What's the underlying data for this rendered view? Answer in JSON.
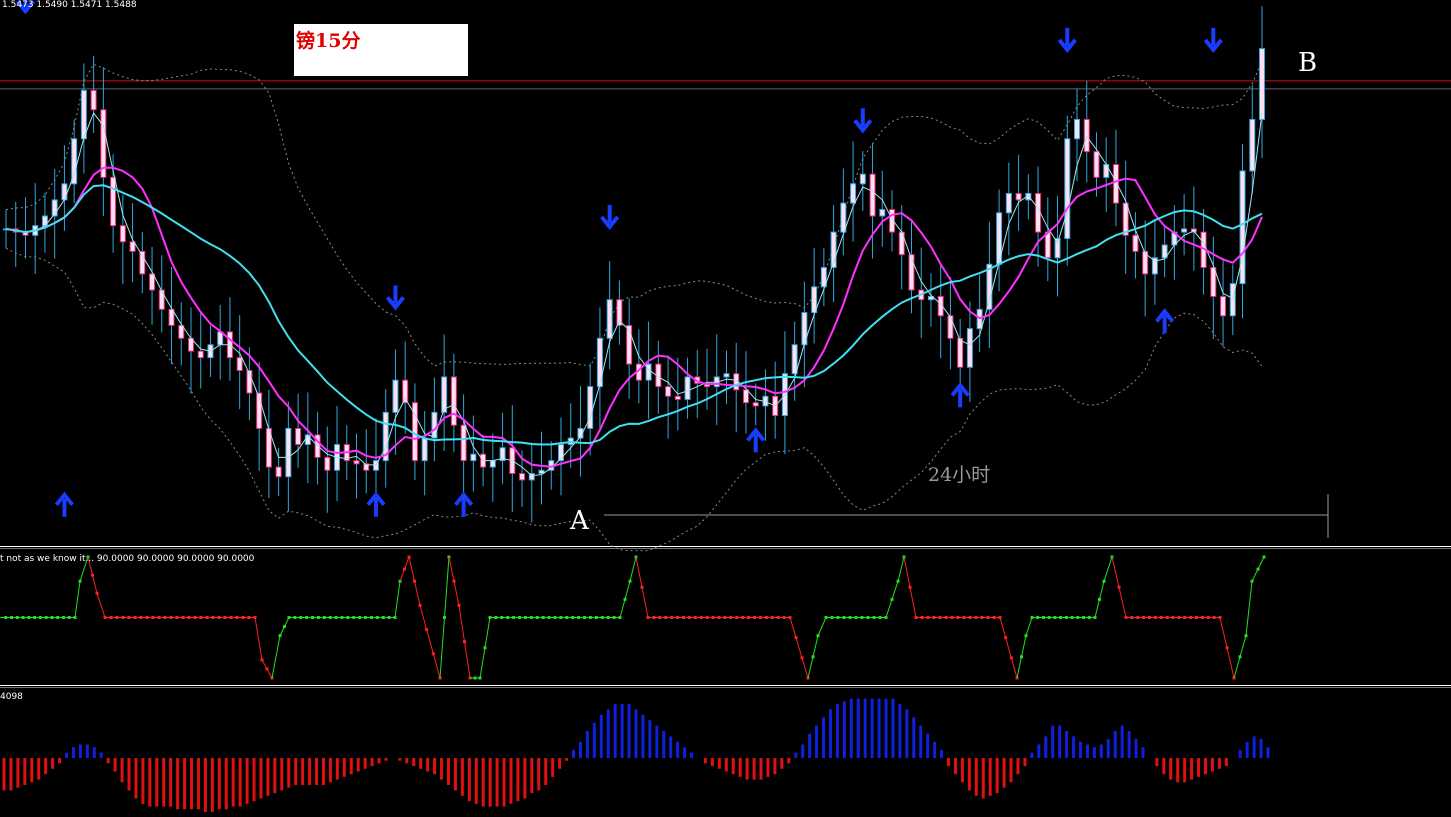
{
  "ohlc_header": "1.5473 1.5490 1.5471 1.5488",
  "annotation_title": "镑15分",
  "point_a": "A",
  "point_b": "B",
  "duration_label": "24小时",
  "oscillator_label": "t not as we know it... 90.0000 90.0000 90.0000 90.0000",
  "histogram_label": "4098",
  "colors": {
    "background": "#000000",
    "candle_body": "#ffe0f0",
    "candle_bear": "#e82a7a",
    "candle_wick": "#2fa8e0",
    "fast_ma": "#ff30ff",
    "slow_ma": "#40e0f0",
    "thin_ma": "#9fe8f0",
    "bollinger": "#8a8a8a",
    "resistance": "#d01010",
    "arrow_down": "#1a3cff",
    "arrow_up": "#1a3cff",
    "osc_up": "#20e020",
    "osc_down": "#ff2020",
    "hist_pos": "#1020e0",
    "hist_neg": "#e01010"
  },
  "chart_data": {
    "type": "line",
    "price": {
      "ymin": 1.534,
      "ymax": 1.55,
      "resistance_level": 1.5478,
      "close": [
        1.5432,
        1.5431,
        1.543,
        1.5433,
        1.5436,
        1.5441,
        1.5446,
        1.546,
        1.5475,
        1.5469,
        1.5448,
        1.5433,
        1.5428,
        1.5425,
        1.5418,
        1.5413,
        1.5407,
        1.5402,
        1.5398,
        1.5394,
        1.5392,
        1.5396,
        1.54,
        1.5392,
        1.5388,
        1.5381,
        1.537,
        1.5358,
        1.5355,
        1.537,
        1.5365,
        1.5368,
        1.5361,
        1.5357,
        1.5365,
        1.536,
        1.5359,
        1.5357,
        1.536,
        1.5375,
        1.5385,
        1.5378,
        1.536,
        1.5367,
        1.5375,
        1.5386,
        1.5371,
        1.536,
        1.5362,
        1.5358,
        1.536,
        1.5364,
        1.5356,
        1.5354,
        1.5356,
        1.5357,
        1.536,
        1.5365,
        1.5367,
        1.537,
        1.5383,
        1.5398,
        1.541,
        1.5402,
        1.539,
        1.5385,
        1.539,
        1.5383,
        1.538,
        1.5379,
        1.5386,
        1.5384,
        1.5383,
        1.5386,
        1.5387,
        1.5382,
        1.5378,
        1.5377,
        1.538,
        1.5374,
        1.5387,
        1.5396,
        1.5406,
        1.5414,
        1.542,
        1.5431,
        1.544,
        1.5446,
        1.5449,
        1.5436,
        1.5438,
        1.5431,
        1.5424,
        1.5413,
        1.541,
        1.5411,
        1.5405,
        1.5398,
        1.5389,
        1.5401,
        1.5407,
        1.5421,
        1.5437,
        1.5443,
        1.5441,
        1.5443,
        1.5431,
        1.5423,
        1.5429,
        1.546,
        1.5466,
        1.5456,
        1.5448,
        1.5452,
        1.544,
        1.543,
        1.5425,
        1.5418,
        1.5423,
        1.5427,
        1.5431,
        1.5432,
        1.5431,
        1.542,
        1.5411,
        1.5405,
        1.5415,
        1.545,
        1.5466,
        1.5488
      ]
    },
    "oscillator": {
      "ymin": 0,
      "ymax": 100,
      "flat_up": 50,
      "flat_down": 50,
      "values": [
        50,
        50,
        50,
        50,
        50,
        50,
        50,
        50,
        50,
        50,
        50,
        50,
        50,
        50,
        50,
        50,
        50,
        50,
        50,
        50,
        50,
        50,
        50,
        50,
        50,
        50,
        50,
        50,
        50,
        50,
        50,
        50,
        50,
        50,
        50,
        50,
        50,
        50,
        50,
        50,
        50,
        50,
        50,
        50,
        50,
        50,
        50,
        50,
        50,
        50,
        50,
        50,
        50,
        50,
        50,
        50,
        50,
        50,
        50,
        50
      ]
    },
    "histogram": {
      "values": [
        -12,
        -12,
        -11,
        -10,
        -9,
        -8,
        -6,
        -4,
        -2,
        2,
        4,
        5,
        5,
        4,
        2,
        -2,
        -5,
        -9,
        -12,
        -15,
        -17,
        -18,
        -18,
        -18,
        -18,
        -19,
        -19,
        -19,
        -19,
        -20,
        -20,
        -19,
        -19,
        -18,
        -18,
        -17,
        -16,
        -15,
        -14,
        -13,
        -12,
        -11,
        -10,
        -10,
        -10,
        -10,
        -10,
        -9,
        -8,
        -7,
        -6,
        -5,
        -4,
        -3,
        -2,
        -1,
        0,
        -1,
        -2,
        -3,
        -4,
        -5,
        -6,
        -8,
        -10,
        -12,
        -14,
        -16,
        -17,
        -18,
        -18,
        -18,
        -18,
        -17,
        -16,
        -15,
        -13,
        -12,
        -10,
        -7,
        -4,
        -1,
        3,
        6,
        10,
        13,
        16,
        18,
        20,
        20,
        20,
        18,
        16,
        14,
        12,
        10,
        8,
        6,
        4,
        2,
        0,
        -2,
        -3,
        -4,
        -5,
        -6,
        -7,
        -8,
        -8,
        -8,
        -7,
        -6,
        -4,
        -2,
        2,
        5,
        9,
        12,
        15,
        18,
        20,
        21,
        22,
        22,
        22,
        22,
        22,
        22,
        22,
        20,
        18,
        15,
        12,
        9,
        6,
        3,
        -3,
        -6,
        -9,
        -12,
        -14,
        -15,
        -14,
        -13,
        -11,
        -9,
        -6,
        -3,
        2,
        5,
        8,
        12,
        12,
        10,
        8,
        6,
        5,
        4,
        5,
        7,
        10,
        12,
        10,
        7,
        4,
        0,
        -3,
        -6,
        -8,
        -9,
        -9,
        -8,
        -7,
        -6,
        -5,
        -4,
        -3,
        0,
        3,
        6,
        8,
        7,
        4
      ]
    },
    "markers": {
      "down": [
        [
          2,
          1.5499
        ],
        [
          40,
          1.5407
        ],
        [
          62,
          1.5432
        ],
        [
          88,
          1.5462
        ],
        [
          109,
          1.5487
        ],
        [
          124,
          1.5487
        ]
      ],
      "up": [
        [
          6,
          1.535
        ],
        [
          38,
          1.535
        ],
        [
          47,
          1.535
        ],
        [
          77,
          1.537
        ],
        [
          98,
          1.5384
        ],
        [
          119,
          1.5407
        ]
      ]
    }
  }
}
